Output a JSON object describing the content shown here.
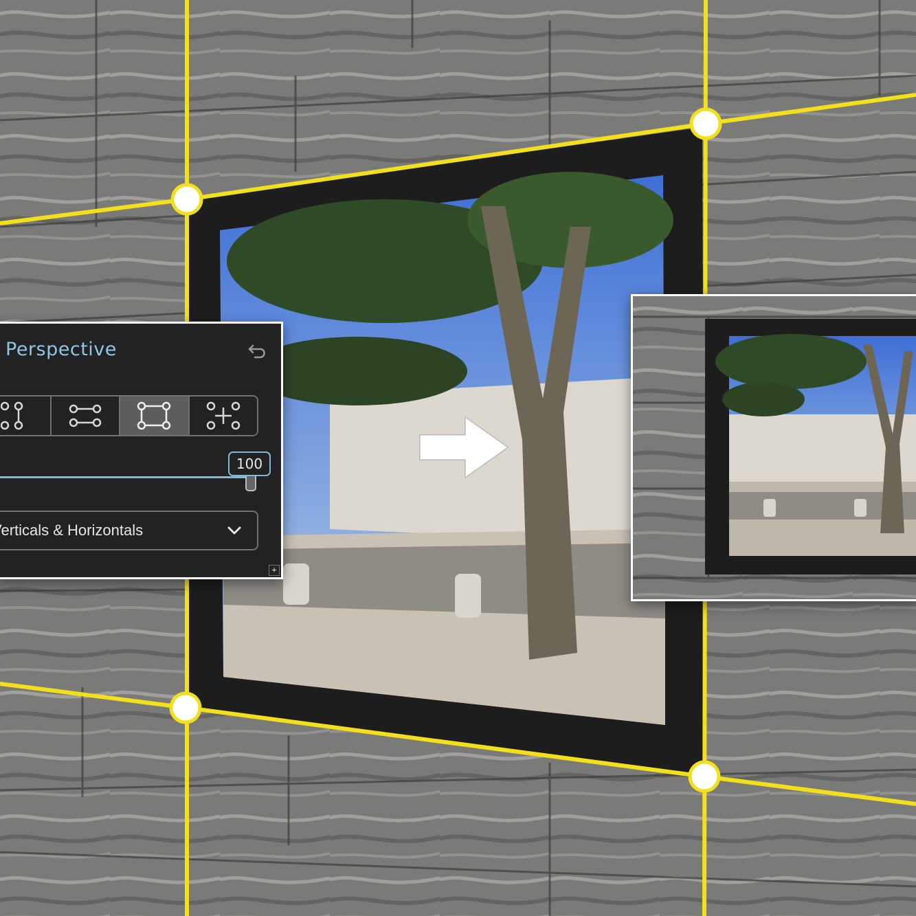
{
  "panel": {
    "title": "Perspective",
    "reset_icon": "undo-icon",
    "modes": [
      {
        "name": "vertical",
        "icon": "vertical-guides-icon",
        "active": false
      },
      {
        "name": "horizontal",
        "icon": "horizontal-guides-icon",
        "active": false
      },
      {
        "name": "rectangle",
        "icon": "rectangle-guides-icon",
        "active": true
      },
      {
        "name": "four-point",
        "icon": "four-point-guides-icon",
        "active": false
      }
    ],
    "amount": {
      "value": "100",
      "level_percent": 100
    },
    "dropdown": {
      "selected": "Verticals & Horizontals",
      "icon": "chevron-down-icon"
    },
    "expand_icon": "plus-icon",
    "expand_label": "+"
  },
  "colors": {
    "guide_yellow": "#f3e01c",
    "accent_blue": "#7cbad9",
    "panel_bg": "#222222"
  },
  "arrow_icon": "arrow-right-icon"
}
